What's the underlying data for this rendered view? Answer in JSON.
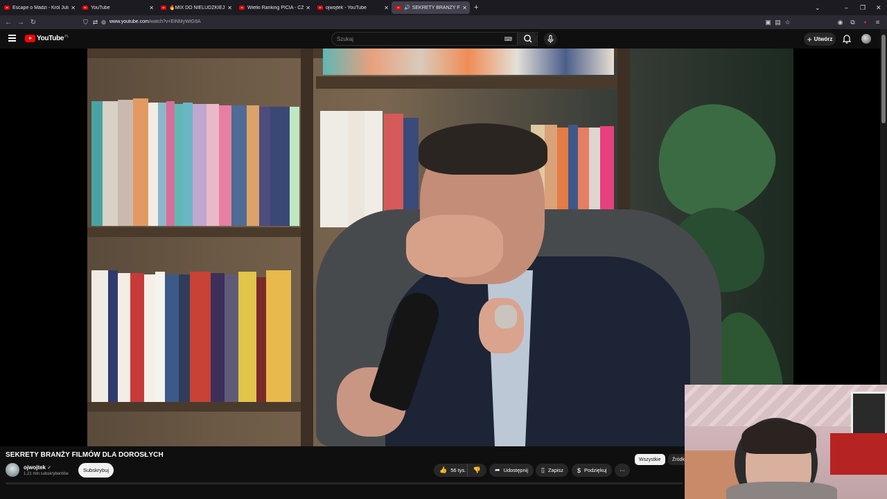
{
  "browser": {
    "tabs": [
      {
        "label": "Escape o Madzi - Król Julian & J",
        "active": false
      },
      {
        "label": "YouTube",
        "active": false
      },
      {
        "label": "🔥MIX DO NIELUDZKIEJ PRACY",
        "active": false
      },
      {
        "label": "Wielki Ranking PICIA - CZEGO",
        "active": false
      },
      {
        "label": "ojwojtek - YouTube",
        "active": false
      },
      {
        "label": "SEKRETY BRANŻY FILMÓW",
        "active": true
      }
    ],
    "url_domain": "www.youtube.com",
    "url_path": "/watch?v=EiNMyWtG9A"
  },
  "youtube": {
    "logo_text": "YouTube",
    "logo_country": "PL",
    "search_placeholder": "Szukaj",
    "create_label": "Utwórz"
  },
  "video": {
    "title": "SEKRETY BRANŻY FILMÓW DLA DOROSŁYCH",
    "channel_name": "ojwojtek",
    "subscribers": "1,21 mln subskrybentów",
    "subscribe_label": "Subskrybuj",
    "likes": "56 tys.",
    "share_label": "Udostępnij",
    "save_label": "Zapisz",
    "thanks_label": "Podziękuj"
  },
  "chips": {
    "all": "Wszystkie",
    "source": "Źródło"
  },
  "colors": {
    "brand_red": "#ff0000",
    "page_bg": "#0f0f0f",
    "pill_bg": "#272727"
  }
}
